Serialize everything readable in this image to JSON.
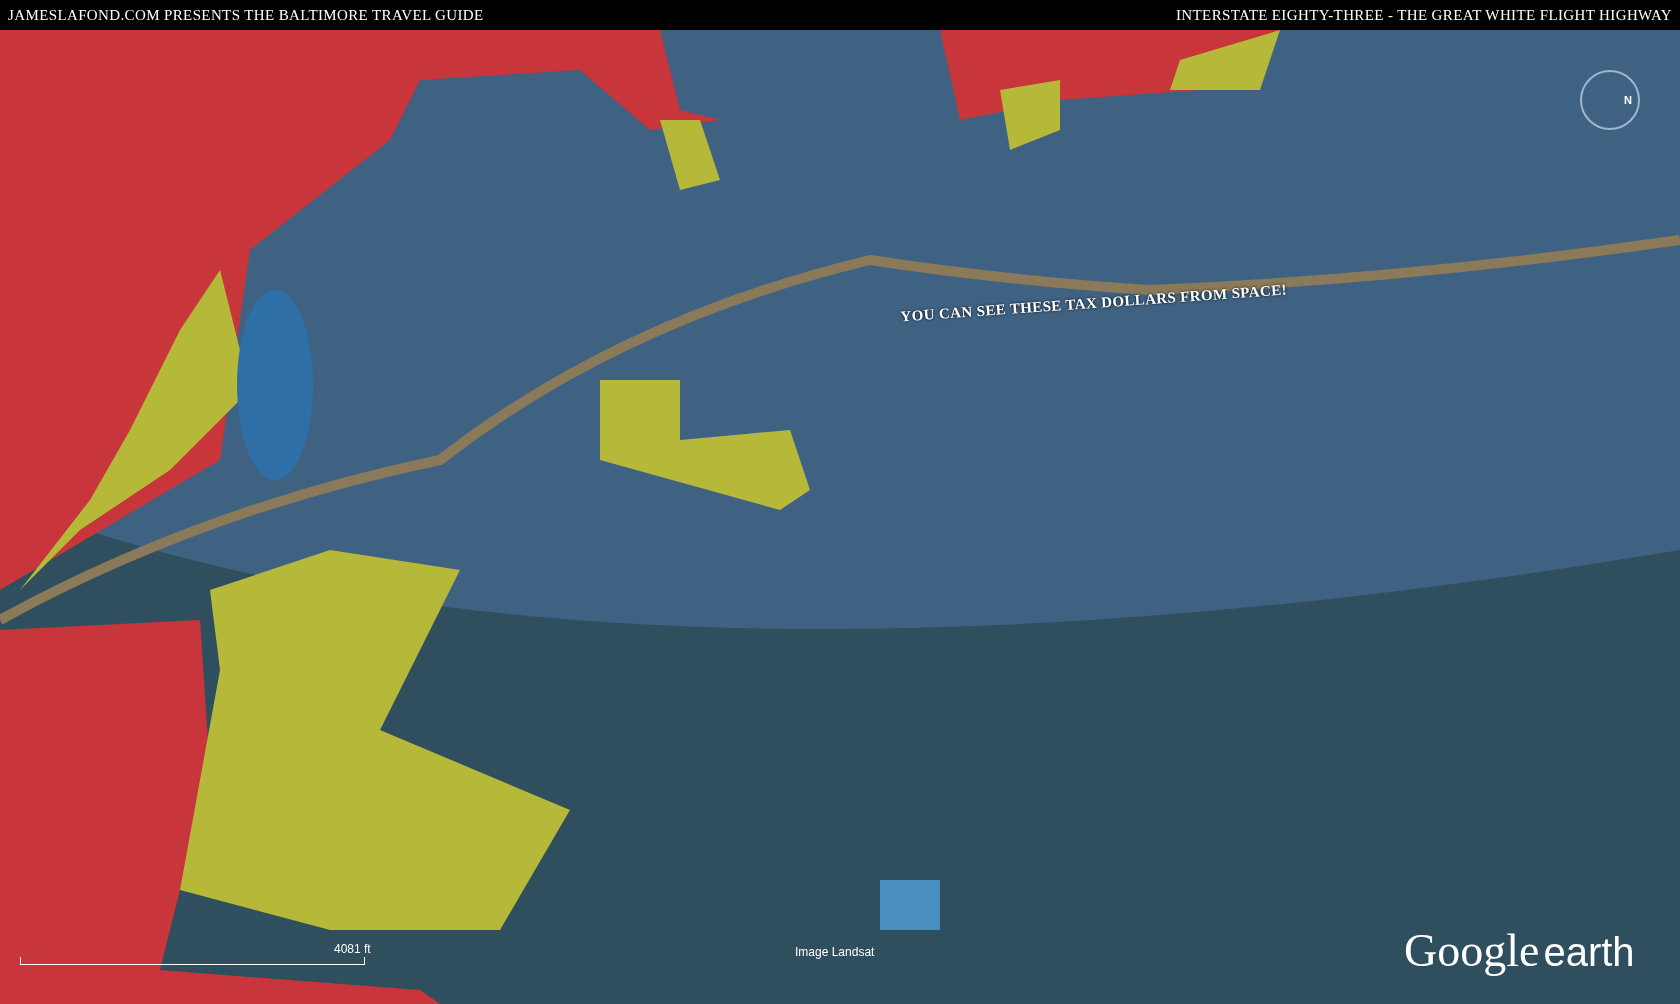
{
  "header": {
    "left_title": "JAMESLAFOND.COM PRESENTS THE BALTIMORE TRAVEL GUIDE",
    "right_title": "INTERSTATE EIGHTY-THREE - THE GREAT WHITE FLIGHT HIGHWAY"
  },
  "map": {
    "annotation": "YOU CAN SEE THESE TAX DOLLARS FROM SPACE!",
    "compass": "N",
    "scale": "4081 ft",
    "attribution": "Image Landsat",
    "logo": {
      "brand": "Google",
      "product": "earth"
    }
  }
}
